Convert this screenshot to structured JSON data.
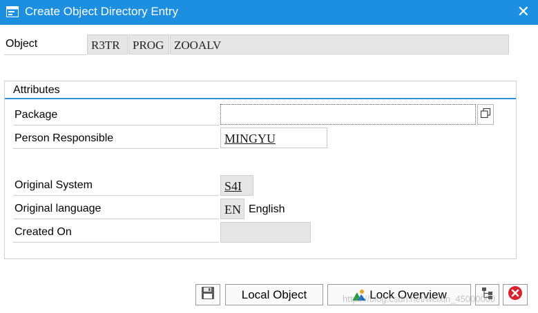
{
  "window": {
    "title": "Create Object Directory Entry",
    "icon": "dialog-window-icon",
    "close_glyph": "✕"
  },
  "object": {
    "label": "Object",
    "pgmid": "R3TR",
    "type": "PROG",
    "name": "ZOOALV"
  },
  "attributes": {
    "title": "Attributes",
    "package": {
      "label": "Package",
      "value": ""
    },
    "person": {
      "label": "Person Responsible",
      "value": "MINGYU"
    },
    "system": {
      "label": "Original System",
      "value": "S4I"
    },
    "language": {
      "label": "Original language",
      "code": "EN",
      "text": "English"
    },
    "created": {
      "label": "Created On",
      "value": ""
    }
  },
  "buttons": {
    "save_icon": "save-icon",
    "local_object": "Local Object",
    "lock_overview": "Lock Overview",
    "org_icon": "hierarchy-icon",
    "cancel_icon": "cancel-icon"
  },
  "watermark": "https://blog.csdn.net/weixin_45000000",
  "colors": {
    "title_bar": "#1c8fe0",
    "accent_rule": "#2b8ed8",
    "cancel": "#d8232a"
  }
}
